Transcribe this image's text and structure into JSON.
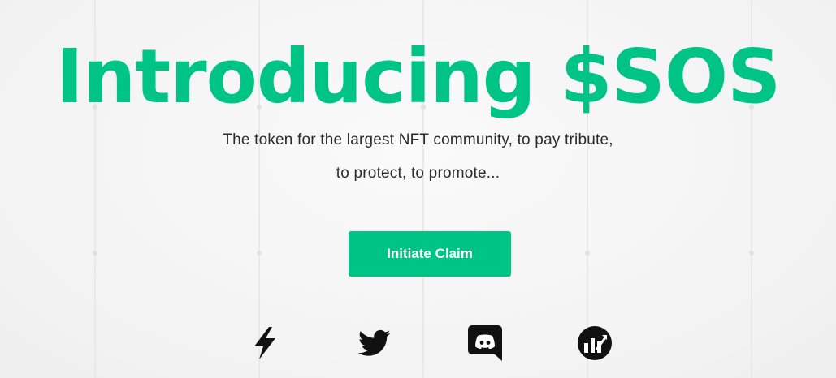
{
  "hero": {
    "headline": "Introducing $SOS",
    "subtitle_line1": "The token for the largest NFT community, to pay tribute,",
    "subtitle_line2": "to protect, to promote..."
  },
  "cta": {
    "label": "Initiate Claim"
  },
  "social_links": [
    {
      "icon": "lightning-icon"
    },
    {
      "icon": "twitter-icon"
    },
    {
      "icon": "discord-icon"
    },
    {
      "icon": "chart-logo-icon"
    }
  ],
  "colors": {
    "accent": "#00c484",
    "text": "#2b2b2b",
    "background": "#f5f5f5",
    "icon": "#111111"
  }
}
